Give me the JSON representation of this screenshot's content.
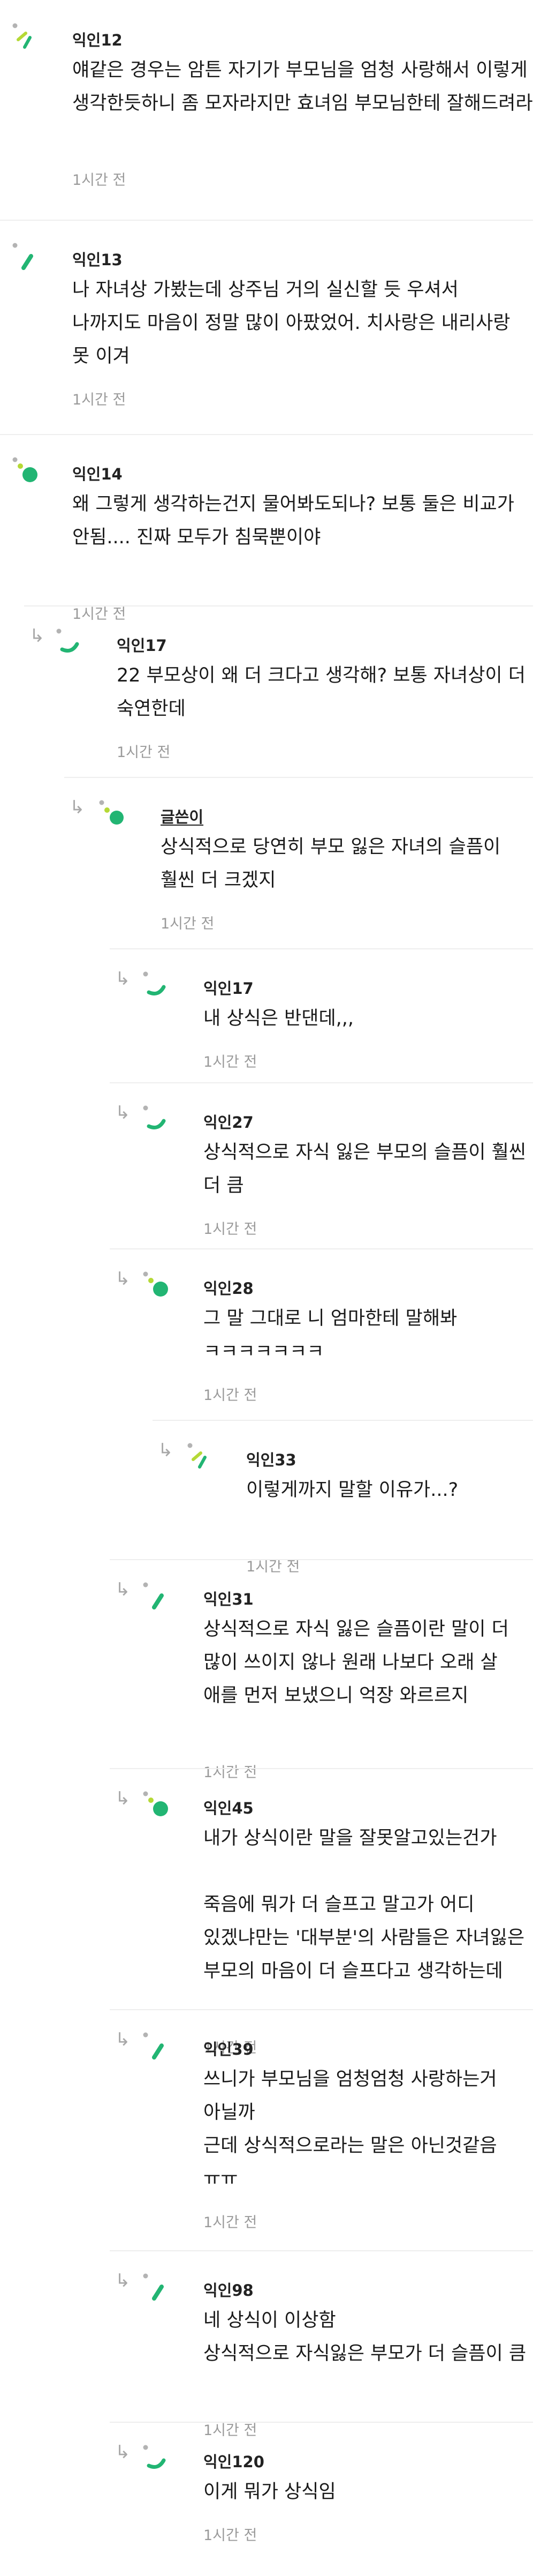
{
  "colors": {
    "avatar_green": "#22b573",
    "avatar_lime": "#b5d936",
    "avatar_dot": "#b3b3b3",
    "reply_arrow": "#a8a8a8",
    "divider": "#eeeeee",
    "time_text": "#9a9a9a"
  },
  "comments": [
    {
      "name": "익인12",
      "is_author": false,
      "is_reply": false,
      "avatar": "avatar-lime-green-icon",
      "text": "얘같은 경우는 암튼 자기가 부모님을 엄청 사랑해서 이렇게 생각한듯하니 좀 모자라지만 효녀임 부모님한테 잘해드려라",
      "time": "1시간 전"
    },
    {
      "name": "익인13",
      "is_author": false,
      "is_reply": false,
      "avatar": "avatar-green-slash-icon",
      "text": "나 자녀상 가봤는데 상주님 거의 실신할 듯 우셔서 나까지도 마음이 정말 많이 아팠었어. 치사랑은 내리사랑 못 이겨",
      "time": "1시간 전"
    },
    {
      "name": "익인14",
      "is_author": false,
      "is_reply": false,
      "avatar": "avatar-green-dot-icon",
      "text": "왜 그렇게 생각하는건지 물어봐도되나? 보통 둘은 비교가 안됨.... 진짜 모두가 침묵뿐이야",
      "time": "1시간 전"
    },
    {
      "name": "익인17",
      "is_author": false,
      "is_reply": true,
      "avatar": "avatar-green-arc-icon",
      "text": "22 부모상이 왜 더 크다고 생각해? 보통 자녀상이 더 숙연한데",
      "time": "1시간 전"
    },
    {
      "name": "글쓴이",
      "is_author": true,
      "is_reply": true,
      "avatar": "avatar-lime-green-dot-icon",
      "text": "상식적으로 당연히 부모 잃은 자녀의 슬픔이 훨씬 더 크겠지",
      "time": "1시간 전"
    },
    {
      "name": "익인17",
      "is_author": false,
      "is_reply": true,
      "avatar": "avatar-green-arc-icon",
      "text": "내 상식은 반댄데,,,",
      "time": "1시간 전"
    },
    {
      "name": "익인27",
      "is_author": false,
      "is_reply": true,
      "avatar": "avatar-green-arc-icon",
      "text": "상식적으로 자식 잃은 부모의 슬픔이 훨씬 더 큼",
      "time": "1시간 전"
    },
    {
      "name": "익인28",
      "is_author": false,
      "is_reply": true,
      "avatar": "avatar-green-dot-icon",
      "text": "그 말 그대로 니 엄마한테 말해봐 ㅋㅋㅋㅋㅋㅋㅋ",
      "time": "1시간 전"
    },
    {
      "name": "익인33",
      "is_author": false,
      "is_reply": true,
      "avatar": "avatar-lime-green-icon",
      "text": "이렇게까지 말할 이유가...?",
      "time": "1시간 전"
    },
    {
      "name": "익인31",
      "is_author": false,
      "is_reply": true,
      "avatar": "avatar-green-slash-icon",
      "text": "상식적으로 자식 잃은 슬픔이란 말이 더 많이 쓰이지 않나 원래 나보다 오래 살 애를 먼저 보냈으니 억장 와르르지",
      "time": "1시간 전"
    },
    {
      "name": "익인45",
      "is_author": false,
      "is_reply": true,
      "avatar": "avatar-green-dot-icon",
      "text": "내가 상식이란 말을 잘못알고있는건가\n죽음에 뭐가 더 슬프고 말고가 어디 있겠냐만는 '대부분'의 사람들은 자녀잃은 부모의 마음이 더 슬프다고 생각하는데",
      "time": "1시간 전"
    },
    {
      "name": "익인39",
      "is_author": false,
      "is_reply": true,
      "avatar": "avatar-green-slash-icon",
      "text": "쓰니가 부모님을 엄청엄청 사랑하는거 아닐까\n근데 상식적으로라는 말은 아닌것같음 ㅠㅠ",
      "time": "1시간 전"
    },
    {
      "name": "익인98",
      "is_author": false,
      "is_reply": true,
      "avatar": "avatar-green-slash-icon",
      "text": "네 상식이 이상함\n상식적으로 자식잃은 부모가 더 슬픔이 큼",
      "time": "1시간 전"
    },
    {
      "name": "익인120",
      "is_author": false,
      "is_reply": true,
      "avatar": "avatar-green-arc-icon",
      "text": "이게 뭐가 상식임",
      "time": "1시간 전"
    }
  ]
}
